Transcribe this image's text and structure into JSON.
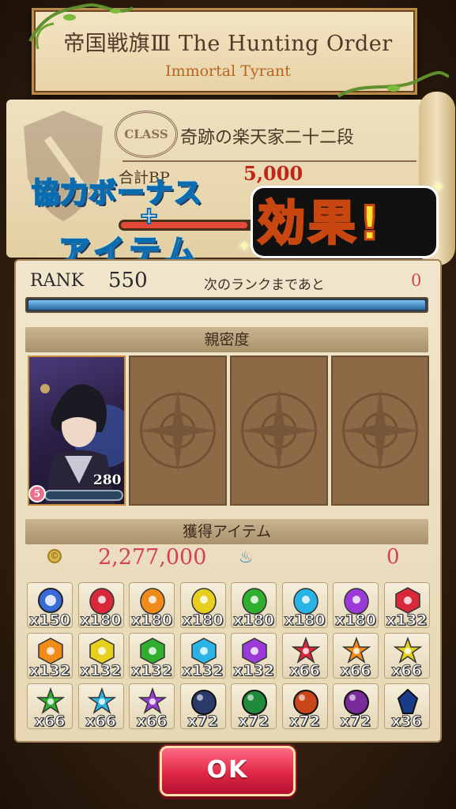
{
  "banner": {
    "title": "帝国戦旗Ⅲ The Hunting Order",
    "subtitle": "Immortal Tyrant"
  },
  "class_scroll": {
    "badge": "CLASS",
    "class_name": "奇跡の楽天家二十二段",
    "bp_label": "合計BP",
    "bp_value": "5,000"
  },
  "promo": {
    "line1": "協力ボーナス",
    "plus": "+",
    "line2": "アイテム",
    "effect": "効果!"
  },
  "rank": {
    "label": "RANK",
    "value": "550",
    "next_label": "次のランクまであと",
    "next_value": "0",
    "progress": 1.0
  },
  "intimacy": {
    "header": "親密度",
    "character": {
      "value": "280",
      "level": "5"
    }
  },
  "rewards": {
    "header": "獲得アイテム",
    "coin": "2,277,000",
    "soul": "0",
    "items": [
      {
        "qty": "x150",
        "color": "#3a6ad8",
        "shape": "orb"
      },
      {
        "qty": "x180",
        "color": "#d8283a",
        "shape": "egg"
      },
      {
        "qty": "x180",
        "color": "#f08a1a",
        "shape": "egg"
      },
      {
        "qty": "x180",
        "color": "#e6cf1e",
        "shape": "egg"
      },
      {
        "qty": "x180",
        "color": "#2fae2f",
        "shape": "egg"
      },
      {
        "qty": "x180",
        "color": "#2ab4e6",
        "shape": "egg"
      },
      {
        "qty": "x180",
        "color": "#9a3ad8",
        "shape": "egg"
      },
      {
        "qty": "x132",
        "color": "#d8283a",
        "shape": "hex"
      },
      {
        "qty": "x132",
        "color": "#f08a1a",
        "shape": "hex"
      },
      {
        "qty": "x132",
        "color": "#e6cf1e",
        "shape": "hex"
      },
      {
        "qty": "x132",
        "color": "#2fae2f",
        "shape": "hex"
      },
      {
        "qty": "x132",
        "color": "#2ab4e6",
        "shape": "hex"
      },
      {
        "qty": "x132",
        "color": "#9a3ad8",
        "shape": "hex"
      },
      {
        "qty": "x66",
        "color": "#d8283a",
        "shape": "star"
      },
      {
        "qty": "x66",
        "color": "#f08a1a",
        "shape": "star"
      },
      {
        "qty": "x66",
        "color": "#e6cf1e",
        "shape": "star"
      },
      {
        "qty": "x66",
        "color": "#2fae2f",
        "shape": "star"
      },
      {
        "qty": "x66",
        "color": "#2ab4e6",
        "shape": "star"
      },
      {
        "qty": "x66",
        "color": "#9a3ad8",
        "shape": "star"
      },
      {
        "qty": "x72",
        "color": "#2a3a6a",
        "shape": "sphere"
      },
      {
        "qty": "x72",
        "color": "#1f8a3a",
        "shape": "sphere"
      },
      {
        "qty": "x72",
        "color": "#c8461a",
        "shape": "sphere"
      },
      {
        "qty": "x72",
        "color": "#7a2a9a",
        "shape": "sphere"
      },
      {
        "qty": "x36",
        "color": "#1a3a8a",
        "shape": "axe"
      }
    ]
  },
  "ok_label": "OK"
}
